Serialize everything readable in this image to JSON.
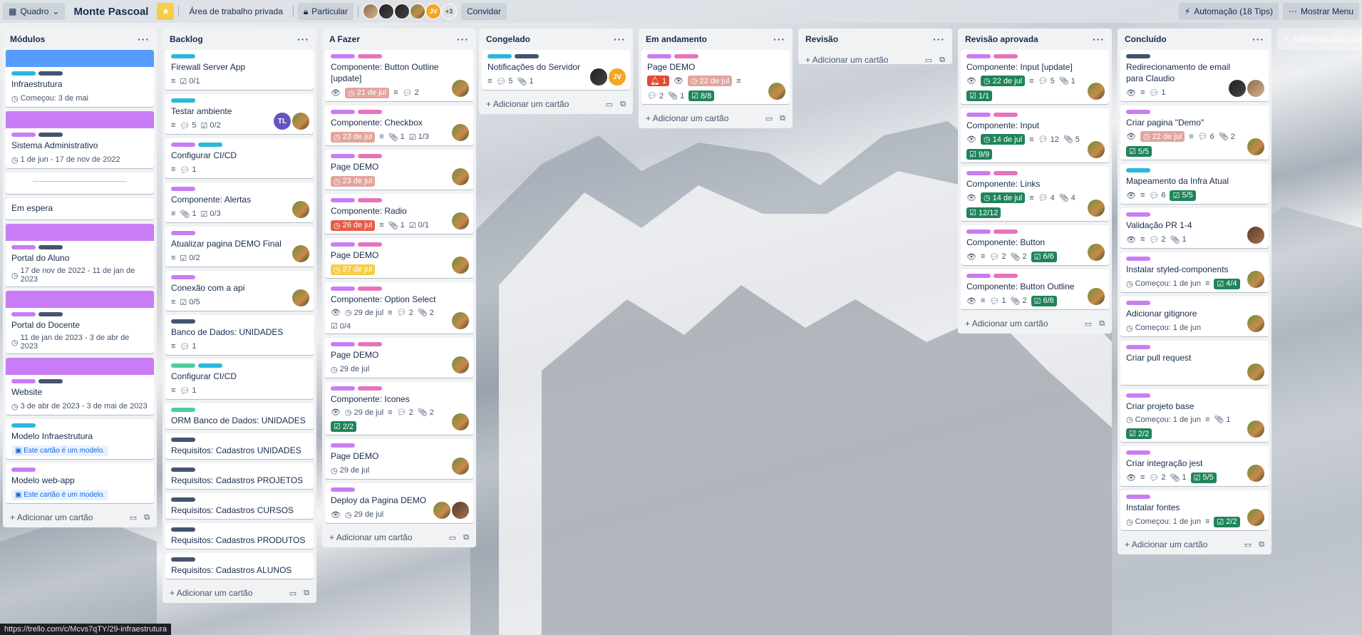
{
  "topbar": {
    "board_type": "Quadro",
    "board_name": "Monte Pascoal",
    "workspace": "Área de trabalho privada",
    "visibility": "Particular",
    "member_more": "+3",
    "invite": "Convidar",
    "automation": "Automação (18 Tips)",
    "menu": "Mostrar Menu"
  },
  "lists": [
    {
      "title": "Módulos",
      "add": "Adicionar um cartão",
      "cards": [
        {
          "title": "Infraestrutura",
          "cover": "#579dff",
          "labels": [
            "#29b8d9",
            "#44546f"
          ],
          "meta": "Começou: 3 de mai"
        },
        {
          "title": "Sistema Administrativo",
          "cover": "#c97cf4",
          "labels": [
            "#c97cf4",
            "#44546f"
          ],
          "meta": "1 de jun - 17 de nov de 2022"
        },
        {
          "title": "",
          "divider": true
        },
        {
          "title": "Em espera"
        },
        {
          "title": "Portal do Aluno",
          "cover": "#c97cf4",
          "labels": [
            "#c97cf4",
            "#44546f"
          ],
          "meta": "17 de nov de 2022 - 11 de jan de 2023"
        },
        {
          "title": "Portal do Docente",
          "cover": "#c97cf4",
          "labels": [
            "#c97cf4",
            "#44546f"
          ],
          "meta": "11 de jan de 2023 - 3 de abr de 2023"
        },
        {
          "title": "Website",
          "cover": "#c97cf4",
          "labels": [
            "#c97cf4",
            "#44546f"
          ],
          "meta": "3 de abr de 2023 - 3 de mai de 2023"
        },
        {
          "title": "Modelo Infraestrutura",
          "labels": [
            "#29b8d9"
          ],
          "model": "Este cartão é um modelo."
        },
        {
          "title": "Modelo web-app",
          "labels": [
            "#c97cf4"
          ],
          "model": "Este cartão é um modelo."
        }
      ]
    },
    {
      "title": "Backlog",
      "add": "Adicionar um cartão",
      "cards": [
        {
          "title": "Firewall Server App",
          "labels": [
            "#29b8d9"
          ],
          "checklist": "0/1"
        },
        {
          "title": "Testar ambiente",
          "labels": [
            "#29b8d9"
          ],
          "comments": "5",
          "checklist": "0/2",
          "members": [
            "TL",
            "p"
          ]
        },
        {
          "title": "Configurar CI/CD",
          "labels": [
            "#c97cf4",
            "#29b8d9"
          ],
          "comments": "1"
        },
        {
          "title": "Componente: Alertas",
          "labels": [
            "#c97cf4"
          ],
          "attach": "1",
          "checklist": "0/3",
          "members": [
            "p"
          ]
        },
        {
          "title": "Atualizar pagina DEMO Final",
          "labels": [
            "#c97cf4"
          ],
          "checklist": "0/2",
          "members": [
            "p"
          ]
        },
        {
          "title": "Conexão com a api",
          "labels": [
            "#c97cf4"
          ],
          "checklist": "0/5",
          "members": [
            "p"
          ]
        },
        {
          "title": "Banco de Dados: UNIDADES",
          "labels": [
            "#44546f"
          ],
          "comments": "1"
        },
        {
          "title": "Configurar CI/CD",
          "labels": [
            "#4bce97",
            "#29b8d9"
          ],
          "comments": "1"
        },
        {
          "title": "ORM Banco de Dados: UNIDADES",
          "labels": [
            "#4bce97"
          ]
        },
        {
          "title": "Requisitos: Cadastros UNIDADES",
          "labels": [
            "#44546f"
          ]
        },
        {
          "title": "Requisitos: Cadastros PROJETOS",
          "labels": [
            "#44546f"
          ]
        },
        {
          "title": "Requisitos: Cadastros CURSOS",
          "labels": [
            "#44546f"
          ]
        },
        {
          "title": "Requisitos: Cadastros PRODUTOS",
          "labels": [
            "#44546f"
          ]
        },
        {
          "title": "Requisitos: Cadastros ALUNOS",
          "labels": [
            "#44546f"
          ]
        }
      ]
    },
    {
      "title": "A Fazer",
      "add": "Adicionar um cartão",
      "cards": [
        {
          "title": "Componente: Button Outline [update]",
          "labels": [
            "#c97cf4",
            "#e774bb"
          ],
          "watch": true,
          "due": "21 de jul",
          "dueclass": "",
          "comments": "2",
          "members": [
            "p"
          ]
        },
        {
          "title": "Componente: Checkbox",
          "labels": [
            "#c97cf4",
            "#e774bb"
          ],
          "due": "23 de jul",
          "dueclass": "",
          "attach": "1",
          "checklist": "1/3",
          "members": [
            "p"
          ]
        },
        {
          "title": "Page DEMO",
          "labels": [
            "#c97cf4",
            "#e774bb"
          ],
          "due": "23 de jul",
          "dueclass": "",
          "members": [
            "p"
          ]
        },
        {
          "title": "Componente: Radio",
          "labels": [
            "#c97cf4",
            "#e774bb"
          ],
          "due": "26 de jul",
          "dueclass": "red",
          "attach": "1",
          "checklist": "0/1",
          "members": [
            "p"
          ]
        },
        {
          "title": "Page DEMO",
          "labels": [
            "#c97cf4",
            "#e774bb"
          ],
          "due": "27 de jul",
          "dueclass": "yel",
          "members": [
            "p"
          ]
        },
        {
          "title": "Componente: Option Select",
          "labels": [
            "#c97cf4",
            "#e774bb"
          ],
          "watch": true,
          "datep": "29 de jul",
          "comments": "2",
          "attach": "2",
          "checklist": "0/4",
          "members": [
            "p"
          ]
        },
        {
          "title": "Page DEMO",
          "labels": [
            "#c97cf4",
            "#e774bb"
          ],
          "datep": "29 de jul",
          "members": [
            "p"
          ]
        },
        {
          "title": "Componente: Icones",
          "labels": [
            "#c97cf4",
            "#e774bb"
          ],
          "watch": true,
          "datep": "29 de jul",
          "comments": "2",
          "attach": "2",
          "checkdone": "2/2",
          "members": [
            "p"
          ]
        },
        {
          "title": "Page DEMO",
          "labels": [
            "#c97cf4"
          ],
          "datep": "29 de jul",
          "members": [
            "p"
          ]
        },
        {
          "title": "Deploy da Pagina DEMO",
          "labels": [
            "#c97cf4"
          ],
          "watch": true,
          "datep": "29 de jul",
          "members": [
            "p",
            "p2"
          ]
        }
      ]
    },
    {
      "title": "Congelado",
      "add": "Adicionar um cartão",
      "cards": [
        {
          "title": "Notificações do Servidor",
          "labels": [
            "#29b8d9",
            "#44546f"
          ],
          "comments": "5",
          "attach": "1",
          "members": [
            "p3",
            "JV"
          ]
        }
      ]
    },
    {
      "title": "Em andamento",
      "add": "Adicionar um cartão",
      "cards": [
        {
          "title": "Page DEMO",
          "labels": [
            "#c97cf4",
            "#e774bb"
          ],
          "notif": "1",
          "watch": true,
          "due": "22 de jul",
          "dueclass": "",
          "comments": "2",
          "attach": "1",
          "checkdone": "8/8",
          "members": [
            "p"
          ]
        }
      ]
    },
    {
      "title": "Revisão",
      "add": "Adicionar um cartão",
      "cards": []
    },
    {
      "title": "Revisão aprovada",
      "add": "Adicionar um cartão",
      "cards": [
        {
          "title": "Componente: Input [update]",
          "labels": [
            "#c97cf4",
            "#e774bb"
          ],
          "watch": true,
          "due": "22 de jul",
          "dueclass": "grn",
          "comments": "5",
          "attach": "1",
          "checkdone": "1/1",
          "members": [
            "p"
          ]
        },
        {
          "title": "Componente: Input",
          "labels": [
            "#c97cf4",
            "#e774bb"
          ],
          "watch": true,
          "due": "14 de jul",
          "dueclass": "grn",
          "comments": "12",
          "attach": "5",
          "checkdone": "9/9",
          "members": [
            "p"
          ]
        },
        {
          "title": "Componente: Links",
          "labels": [
            "#c97cf4",
            "#e774bb"
          ],
          "watch": true,
          "due": "14 de jul",
          "dueclass": "grn",
          "comments": "4",
          "attach": "4",
          "checkdone": "12/12",
          "members": [
            "p"
          ]
        },
        {
          "title": "Componente: Button",
          "labels": [
            "#c97cf4",
            "#e774bb"
          ],
          "watch": true,
          "comments": "2",
          "attach": "2",
          "checkdone": "6/6",
          "members": [
            "p"
          ]
        },
        {
          "title": "Componente: Button Outline",
          "labels": [
            "#c97cf4",
            "#e774bb"
          ],
          "watch": true,
          "comments": "1",
          "attach": "2",
          "checkdone": "6/6",
          "members": [
            "p"
          ]
        }
      ]
    },
    {
      "title": "Concluído",
      "add": "Adicionar um cartão",
      "cards": [
        {
          "title": "Redirecionamento de email para Claudio",
          "labels": [
            "#44546f"
          ],
          "watch": true,
          "comments": "1",
          "members": [
            "p3",
            "p4"
          ]
        },
        {
          "title": "Criar pagina \"Demo\"",
          "labels": [
            "#c97cf4"
          ],
          "watch": true,
          "due": "22 de jul",
          "dueclass": "",
          "comments": "6",
          "attach": "2",
          "checkdone": "5/5",
          "members": [
            "p"
          ]
        },
        {
          "title": "Mapeamento da Infra Atual",
          "labels": [
            "#29b8d9"
          ],
          "watch": true,
          "comments": "6",
          "checkdone": "5/5"
        },
        {
          "title": "Validação PR 1-4",
          "labels": [
            "#c97cf4"
          ],
          "watch": true,
          "comments": "2",
          "attach": "1",
          "members": [
            "p2"
          ]
        },
        {
          "title": "Instalar styled-components",
          "labels": [
            "#c97cf4"
          ],
          "datep": "Começou: 1 de jun",
          "checkdone": "4/4",
          "members": [
            "p"
          ]
        },
        {
          "title": "Adicionar gitignore",
          "labels": [
            "#c97cf4"
          ],
          "datep": "Começou: 1 de jun",
          "members": [
            "p"
          ]
        },
        {
          "title": "Criar pull request",
          "labels": [
            "#c97cf4"
          ],
          "members": [
            "p"
          ]
        },
        {
          "title": "Criar projeto base",
          "labels": [
            "#c97cf4"
          ],
          "datep": "Começou: 1 de jun",
          "attach": "1",
          "checkdone": "2/2",
          "members": [
            "p"
          ]
        },
        {
          "title": "Criar integração jest",
          "labels": [
            "#c97cf4"
          ],
          "watch": true,
          "comments": "2",
          "attach": "1",
          "checkdone": "5/5",
          "members": [
            "p"
          ]
        },
        {
          "title": "Instalar fontes",
          "labels": [
            "#c97cf4"
          ],
          "datep": "Começou: 1 de jun",
          "checkdone": "2/2",
          "members": [
            "p"
          ]
        }
      ]
    }
  ],
  "add_list": "Adicionar outra lista",
  "status_url": "https://trello.com/c/Mcvs7qTY/29-infraestrutura"
}
